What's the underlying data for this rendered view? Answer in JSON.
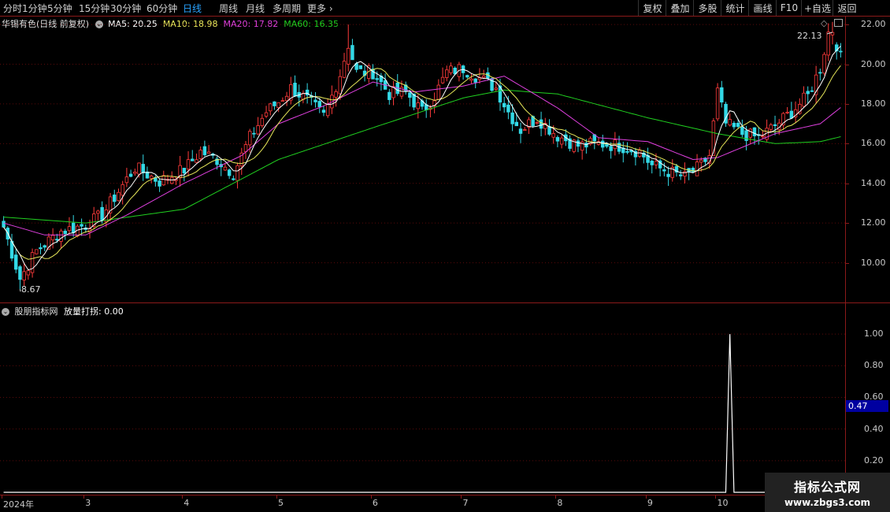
{
  "toolbar": {
    "left_items": [
      "分时",
      "1分钟",
      "5分钟",
      "15分钟",
      "30分钟",
      "60分钟",
      "日线",
      "周线",
      "月线",
      "多周期",
      "更多"
    ],
    "active_index": 6,
    "right_items": [
      "复权",
      "叠加",
      "多股",
      "统计",
      "画线",
      "F10",
      "+自选",
      "返回"
    ]
  },
  "main_chart": {
    "stock_name": "华锡有色(日线 前复权)",
    "ma5": "MA5: 20.25",
    "ma10": "MA10: 18.98",
    "ma20": "MA20: 17.82",
    "ma60": "MA60: 16.35",
    "high_label": "22.13",
    "low_label": "8.67",
    "y_labels": [
      "22.00",
      "20.00",
      "18.00",
      "16.00",
      "14.00",
      "12.00",
      "10.00"
    ],
    "colors": {
      "ma5": "#ffffff",
      "ma10": "#e8e85a",
      "ma20": "#e040e0",
      "ma60": "#20d020",
      "up": "#ff3b3b",
      "down": "#33d9e6"
    }
  },
  "indicator": {
    "title": "股朋指标网",
    "line_label": "放量打拐: 0.00",
    "y_labels": [
      "1.00",
      "0.80",
      "0.60",
      "0.40",
      "0.20"
    ],
    "highlight_value": "0.47"
  },
  "dates": [
    "2024年",
    "3",
    "4",
    "5",
    "6",
    "7",
    "8",
    "9",
    "10"
  ],
  "watermark": {
    "title": "指标公式网",
    "url": "www.zbgs3.com"
  },
  "chart_data": {
    "type": "candlestick",
    "ylim": [
      8,
      22.4
    ],
    "month_starts": [
      0,
      20,
      44,
      67,
      90,
      112,
      135,
      157,
      174
    ],
    "n_bars": 205,
    "close_path": [
      [
        0,
        11.8
      ],
      [
        4,
        9.2
      ],
      [
        8,
        10.6
      ],
      [
        14,
        11.6
      ],
      [
        20,
        11.9
      ],
      [
        24,
        12.4
      ],
      [
        28,
        13.6
      ],
      [
        32,
        14.8
      ],
      [
        38,
        14.1
      ],
      [
        44,
        14.7
      ],
      [
        48,
        15.6
      ],
      [
        52,
        15.2
      ],
      [
        56,
        14.5
      ],
      [
        60,
        16.3
      ],
      [
        64,
        17.6
      ],
      [
        67,
        18.1
      ],
      [
        70,
        18.8
      ],
      [
        74,
        18.2
      ],
      [
        78,
        17.4
      ],
      [
        80,
        18.4
      ],
      [
        82,
        19.5
      ],
      [
        84,
        21.0
      ],
      [
        86,
        19.6
      ],
      [
        90,
        19.6
      ],
      [
        94,
        18.5
      ],
      [
        98,
        18.6
      ],
      [
        102,
        17.6
      ],
      [
        105,
        18.4
      ],
      [
        108,
        19.6
      ],
      [
        112,
        19.8
      ],
      [
        116,
        19.3
      ],
      [
        120,
        18.8
      ],
      [
        123,
        17.6
      ],
      [
        126,
        16.7
      ],
      [
        130,
        17.3
      ],
      [
        135,
        16.4
      ],
      [
        140,
        15.9
      ],
      [
        145,
        16.0
      ],
      [
        150,
        15.9
      ],
      [
        155,
        15.6
      ],
      [
        158,
        14.9
      ],
      [
        162,
        14.6
      ],
      [
        166,
        14.3
      ],
      [
        170,
        14.9
      ],
      [
        172,
        15.4
      ],
      [
        174,
        18.6
      ],
      [
        176,
        17.0
      ],
      [
        180,
        16.5
      ],
      [
        184,
        16.3
      ],
      [
        188,
        16.9
      ],
      [
        192,
        17.6
      ],
      [
        196,
        18.4
      ],
      [
        199,
        19.8
      ],
      [
        201,
        21.6
      ],
      [
        203,
        21.0
      ],
      [
        204,
        20.3
      ]
    ],
    "ma60_path": [
      [
        0,
        12.3
      ],
      [
        20,
        12.0
      ],
      [
        44,
        12.7
      ],
      [
        67,
        15.2
      ],
      [
        90,
        16.8
      ],
      [
        112,
        18.3
      ],
      [
        122,
        18.7
      ],
      [
        135,
        18.5
      ],
      [
        157,
        17.3
      ],
      [
        174,
        16.5
      ],
      [
        188,
        16.0
      ],
      [
        199,
        16.1
      ],
      [
        204,
        16.35
      ]
    ],
    "ma20_path": [
      [
        0,
        12.0
      ],
      [
        10,
        11.4
      ],
      [
        20,
        11.4
      ],
      [
        30,
        12.4
      ],
      [
        44,
        14.0
      ],
      [
        58,
        15.4
      ],
      [
        67,
        17.0
      ],
      [
        78,
        17.9
      ],
      [
        90,
        19.1
      ],
      [
        100,
        18.6
      ],
      [
        112,
        18.9
      ],
      [
        122,
        19.4
      ],
      [
        135,
        17.8
      ],
      [
        145,
        16.3
      ],
      [
        157,
        16.1
      ],
      [
        168,
        15.2
      ],
      [
        174,
        15.3
      ],
      [
        188,
        16.5
      ],
      [
        199,
        17.0
      ],
      [
        204,
        17.82
      ]
    ],
    "indicator_series": {
      "spike_index": 177,
      "spike_value": 1.0,
      "ylim": [
        0,
        1.1
      ]
    }
  }
}
